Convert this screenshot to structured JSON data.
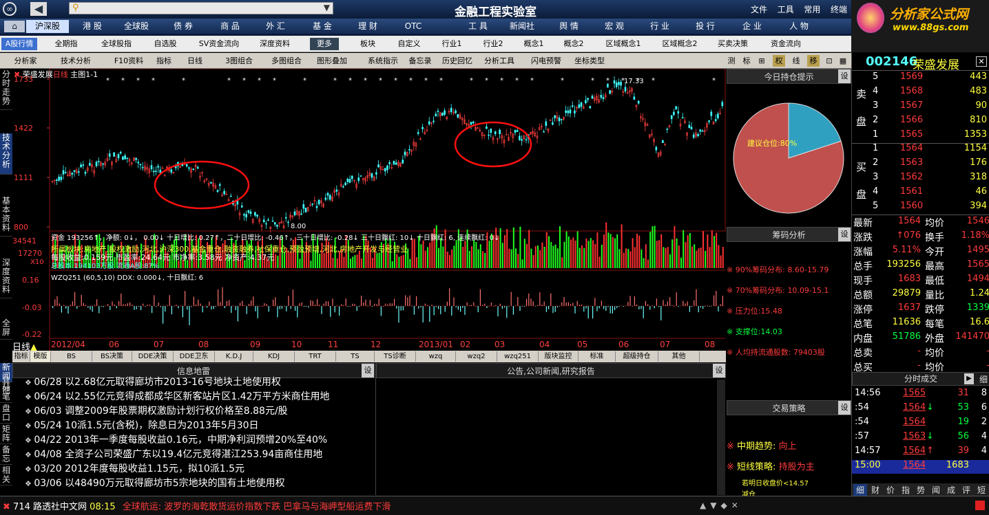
{
  "window": {
    "title": "金融工程实验室",
    "menu": [
      "文件",
      "工具",
      "常用",
      "终端"
    ],
    "brand": "分析家公式网",
    "brand_url": "www.88gs.com"
  },
  "market_tabs": [
    "沪深股",
    "港 股",
    "全球股",
    "债 券",
    "商 品",
    "外 汇",
    "基 金",
    "理 财",
    "OTC"
  ],
  "right_tabs": [
    "工 具",
    "新闻社",
    "舆 情",
    "宏 观",
    "行 业",
    "投 行",
    "企 业",
    "人 物"
  ],
  "toolbar3": [
    "A股行情",
    "全期指",
    "全球股指",
    "自选股",
    "SV资金流向",
    "深度资料",
    "更多",
    "板块",
    "自定义",
    "行业1",
    "行业2",
    "概念1",
    "概念2",
    "区域概念1",
    "区域概念2",
    "买卖决策",
    "资金流向"
  ],
  "toolbar4": [
    "分析家",
    "技术分析",
    "F10资料",
    "指标",
    "日线",
    "3图组合",
    "多图组合",
    "图形叠加",
    "系统指示",
    "备忘录",
    "历史回忆",
    "分析工具",
    "闪电预警",
    "坐标类型",
    "测",
    "标",
    "权",
    "线",
    "移"
  ],
  "left_tabs": [
    "分时走势",
    "技术分析",
    "基本资料",
    "深度资料",
    "全屏"
  ],
  "left_tabs2": [
    "新闻",
    "分笔",
    "盘口",
    "矩阵",
    "备忘",
    "相关"
  ],
  "left_tabs3": [
    "其他"
  ],
  "chart": {
    "stock_title": "荣盛发展",
    "period": "日线",
    "main": "主图1-1",
    "prices": [
      "1733",
      "1422",
      "1111",
      "800"
    ],
    "high_label": "17.33",
    "low_label": "8.00",
    "vol_labels": [
      "34541",
      "17270",
      "X10"
    ],
    "ddx_labels": [
      "0.16",
      "-0.03",
      "-0.22"
    ],
    "fund_line": "资金 193256↑，净额: 0↓， 0.00↓ 十日增比: 0.27↑，二十日增比: -0.46↑，三十日增比: -0.28↓ 三十日飘红: 10↓ 十日飘红: 6, 连续飘红: 0↓",
    "sector_line": "所属板块:房地产,股权激励,河北,沪深300,基金重仓,融资融券,社保重仓,预盈预增,河北,房地产开发与经营业",
    "eps_line": "每股收益:0.159元 市盈率:24.64元 市净率:3.58元 净资产:4.37元",
    "flow_line": "总股本:194103万股 流通A股:87%",
    "ddx_line": "WZQ251 (60,5,10) DDX: 0.000↓, 十日飘红: 6",
    "dates": [
      "日线",
      "2012/04",
      "06",
      "07",
      "08",
      "09",
      "10",
      "11",
      "12",
      "2013/01",
      "02",
      "03",
      "04",
      "05",
      "06",
      "07",
      "08"
    ]
  },
  "indicator_tabs": [
    "指标",
    "模版",
    "BS",
    "BS决策",
    "DDE决策",
    "DDE卫东",
    "K.D.J",
    "KDJ",
    "TRT",
    "TS",
    "TS诊断",
    "wzq",
    "wzq2",
    "wzq251",
    "版块监控",
    "标准",
    "超级持仓",
    "其他"
  ],
  "panels": {
    "pie_title": "今日持仓提示",
    "pie_label": "建议仓位:80%",
    "pie_value": 80,
    "chip_title": "筹码分析",
    "chip_lines": [
      "90%筹码分布: 8.60-15.79",
      "70%筹码分布: 10.09-15.1",
      "压力位:15.48",
      "支撑位:14.03",
      "人均持流通股数: 79403股"
    ],
    "strategy_title": "交易策略",
    "strategy": [
      {
        "k": "中期趋势:",
        "v": "向上"
      },
      {
        "k": "短线策略:",
        "v": "持股为主"
      }
    ],
    "strategy_note": "若明日收盘价<14.57",
    "strategy_note2": "减仓",
    "set": "设"
  },
  "news": {
    "title": "信息地雷",
    "ann_title": "公告,公司新闻,研究报告",
    "items": [
      "06/28 以2.68亿元取得廊坊市2013-16号地块土地使用权",
      "06/24 以2.55亿元竞得成都成华区新客站片区1.42万平方米商住用地",
      "06/03 调整2009年股票期权激励计划行权价格至8.88元/股",
      "05/24 10派1.5元(含税)，除息日为2013年5月30日",
      "04/22 2013年一季度每股收益0.16元，中期净利润预增20%至40%",
      "04/08 全资子公司荣盛广东以19.4亿元竞得湛江253.94亩商住用地",
      "03/20 2012年度每股收益1.15元，拟10派1.5元",
      "03/06 以48490万元取得廊坊市5宗地块的国有土地使用权"
    ]
  },
  "quote": {
    "code": "002146",
    "name": "荣盛发展",
    "sell_label": [
      "卖",
      "盘"
    ],
    "buy_label": [
      "买",
      "盘"
    ],
    "asks": [
      {
        "n": "5",
        "p": "1569",
        "v": "443"
      },
      {
        "n": "4",
        "p": "1568",
        "v": "483"
      },
      {
        "n": "3",
        "p": "1567",
        "v": "90"
      },
      {
        "n": "2",
        "p": "1566",
        "v": "810"
      },
      {
        "n": "1",
        "p": "1565",
        "v": "1353"
      }
    ],
    "bids": [
      {
        "n": "1",
        "p": "1564",
        "v": "1154"
      },
      {
        "n": "2",
        "p": "1563",
        "v": "176"
      },
      {
        "n": "3",
        "p": "1562",
        "v": "318"
      },
      {
        "n": "4",
        "p": "1561",
        "v": "46"
      },
      {
        "n": "5",
        "p": "1560",
        "v": "394"
      }
    ],
    "stats": [
      [
        "最新",
        "1564",
        "均价",
        "1546"
      ],
      [
        "涨跌",
        "↑076",
        "换手",
        "1.18%"
      ],
      [
        "涨幅",
        "5.11%",
        "今开",
        "1495"
      ],
      [
        "总手",
        "193256",
        "最高",
        "1565"
      ],
      [
        "现手",
        "1683",
        "最低",
        "1494"
      ],
      [
        "总额",
        "29879",
        "量比",
        "1.24"
      ],
      [
        "涨停",
        "1637",
        "跌停",
        "1339"
      ],
      [
        "总笔",
        "11636",
        "每笔",
        "16.6"
      ],
      [
        "内盘",
        "51786",
        "外盘",
        "141470"
      ],
      [
        "总卖",
        "-",
        "均价",
        "-"
      ],
      [
        "总买",
        "-",
        "均价",
        "-"
      ]
    ],
    "ticks_title": "分时成交",
    "ticks": [
      {
        "t": "14:56",
        "p": "1565",
        "v": "31",
        "c": "8",
        "a": ""
      },
      {
        "t": ":54",
        "p": "1564",
        "v": "53",
        "c": "6",
        "a": "↓"
      },
      {
        "t": ":54",
        "p": "1564",
        "v": "19",
        "c": "2",
        "a": ""
      },
      {
        "t": ":57",
        "p": "1563",
        "v": "56",
        "c": "4",
        "a": "↓"
      },
      {
        "t": "14:57",
        "p": "1564",
        "v": "39",
        "c": "4",
        "a": "↑"
      },
      {
        "t": "15:00",
        "p": "1564",
        "v": "1683",
        "c": "",
        "a": ""
      }
    ],
    "bottom_tabs": [
      "细",
      "财",
      "价",
      "指",
      "势",
      "闻",
      "成",
      "评",
      "短"
    ]
  },
  "ticker": {
    "num": "714",
    "src": "路透社中文网",
    "time": "08:15",
    "text": "全球航运: 波罗的海乾散货运价指数下跌 巴拿马与海岬型船运费下滑"
  },
  "colors": {
    "up": "#ff3b3b",
    "down": "#00ff40",
    "accent": "#ffff40"
  }
}
